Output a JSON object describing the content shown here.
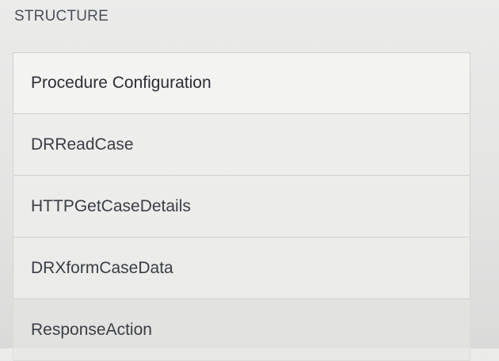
{
  "structure": {
    "title": "STRUCTURE",
    "items": [
      {
        "label": "Procedure Configuration"
      },
      {
        "label": "DRReadCase"
      },
      {
        "label": "HTTPGetCaseDetails"
      },
      {
        "label": "DRXformCaseData"
      },
      {
        "label": "ResponseAction"
      }
    ]
  }
}
